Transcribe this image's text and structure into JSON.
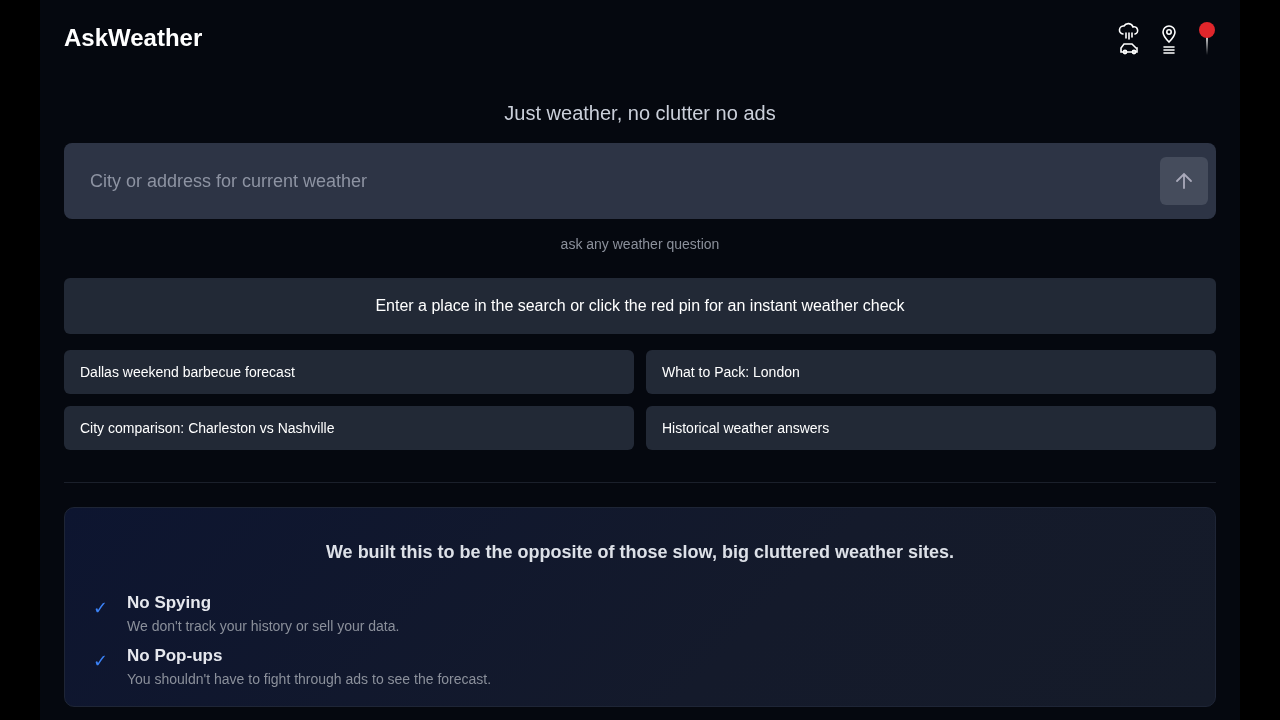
{
  "header": {
    "logo": "AskWeather"
  },
  "tagline": "Just weather, no clutter no ads",
  "search": {
    "placeholder": "City or address for current weather"
  },
  "hint": "ask any weather question",
  "notice": "Enter a place in the search or click the red pin for an instant weather check",
  "suggestions": [
    "Dallas weekend barbecue forecast",
    "What to Pack: London",
    "City comparison: Charleston vs Nashville",
    "Historical weather answers"
  ],
  "about": {
    "title": "We built this to be the opposite of those slow, big cluttered weather sites.",
    "features": [
      {
        "mark": "✓",
        "title": "No Spying",
        "text": "We don't track your history or sell your data."
      },
      {
        "mark": "✓",
        "title": "No Pop-ups",
        "text": "You shouldn't have to fight through ads to see the forecast."
      }
    ]
  }
}
